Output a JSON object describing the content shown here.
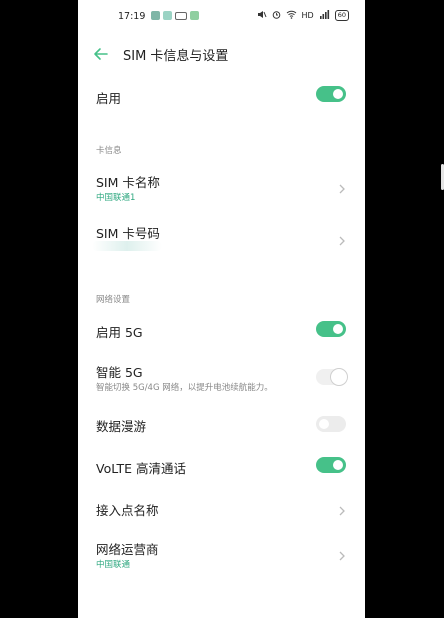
{
  "status_bar": {
    "time": "17:19",
    "network": "HD",
    "battery": "60"
  },
  "header": {
    "title": "SIM 卡信息与设置"
  },
  "enable": {
    "label": "启用",
    "state": true
  },
  "sections": {
    "card_info": "卡信息",
    "network_settings": "网络设置"
  },
  "sim_name": {
    "label": "SIM 卡名称",
    "value": "中国联通1"
  },
  "sim_number": {
    "label": "SIM 卡号码"
  },
  "enable_5g": {
    "label": "启用 5G",
    "state": true
  },
  "smart_5g": {
    "label": "智能 5G",
    "description": "智能切换 5G/4G 网络，以提升电池续航能力。",
    "state": true
  },
  "data_roaming": {
    "label": "数据漫游",
    "state": false
  },
  "volte": {
    "label": "VoLTE 高清通话",
    "state": true
  },
  "apn": {
    "label": "接入点名称"
  },
  "operator": {
    "label": "网络运营商",
    "value": "中国联通"
  },
  "colors": {
    "accent": "#46c189",
    "subtext_accent": "#2fa880"
  }
}
